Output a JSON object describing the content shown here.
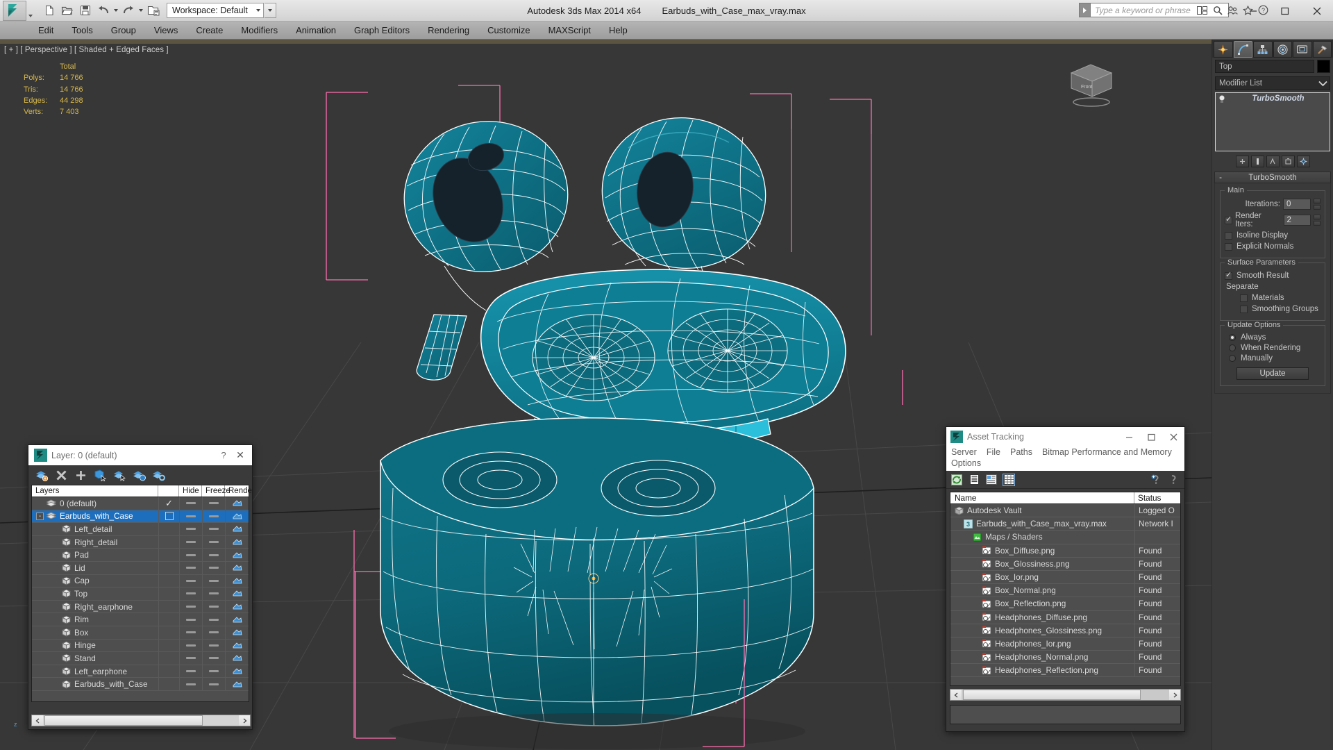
{
  "titlebar": {
    "logo_name": "3ds-max-logo",
    "workspace_label": "Workspace: Default",
    "app_title": "Autodesk 3ds Max  2014 x64",
    "file_name": "Earbuds_with_Case_max_vray.max",
    "search_placeholder": "Type a keyword or phrase",
    "quick_access": [
      {
        "name": "new-file-icon",
        "tip": "New"
      },
      {
        "name": "open-file-icon",
        "tip": "Open"
      },
      {
        "name": "save-file-icon",
        "tip": "Save"
      },
      {
        "name": "undo-icon",
        "tip": "Undo"
      },
      {
        "name": "redo-icon",
        "tip": "Redo"
      },
      {
        "name": "set-project-folder-icon",
        "tip": "Set Project Folder"
      }
    ],
    "right_icons": [
      {
        "name": "workspace-switch-icon"
      },
      {
        "name": "search-icon"
      },
      {
        "name": "community-icon"
      },
      {
        "name": "favorites-icon"
      },
      {
        "name": "help-icon"
      }
    ],
    "window_controls": {
      "minimize": "–",
      "maximize": "□",
      "close": "✕"
    }
  },
  "menubar": {
    "items": [
      "Edit",
      "Tools",
      "Group",
      "Views",
      "Create",
      "Modifiers",
      "Animation",
      "Graph Editors",
      "Rendering",
      "Customize",
      "MAXScript",
      "Help"
    ]
  },
  "viewport": {
    "label": "[ + ] [ Perspective ] [ Shaded + Edged Faces ]",
    "stats_header": "Total",
    "stats": [
      {
        "label": "Polys:",
        "value": "14 766"
      },
      {
        "label": "Tris:",
        "value": "14 766"
      },
      {
        "label": "Edges:",
        "value": "44 298"
      },
      {
        "label": "Verts:",
        "value": "7 403"
      }
    ],
    "axis_z_label": "z",
    "viewcube_label": "Front",
    "colors": {
      "background": "#373737",
      "mesh_fill": "#0b6b7d",
      "mesh_fill_light": "#158ba3",
      "wireframe": "#ffffff",
      "selection_bracket": "#ff78b4",
      "grid": "#4a4a4a"
    }
  },
  "command_panel": {
    "tabs": [
      {
        "name": "create-tab",
        "icon": "star-icon",
        "active": false
      },
      {
        "name": "modify-tab",
        "icon": "curve-icon",
        "active": true
      },
      {
        "name": "hierarchy-tab",
        "icon": "hierarchy-icon",
        "active": false
      },
      {
        "name": "motion-tab",
        "icon": "motion-icon",
        "active": false
      },
      {
        "name": "display-tab",
        "icon": "display-icon",
        "active": false
      },
      {
        "name": "utilities-tab",
        "icon": "hammer-icon",
        "active": false
      }
    ],
    "object_name": "Top",
    "object_color": "#000000",
    "modifier_list_label": "Modifier List",
    "modifier_stack": [
      {
        "name": "TurboSmooth",
        "light_bulb": true
      }
    ],
    "stack_buttons": [
      {
        "name": "pin-stack-button"
      },
      {
        "name": "show-end-result-button"
      },
      {
        "name": "make-unique-button"
      },
      {
        "name": "remove-modifier-button"
      },
      {
        "name": "configure-modifier-sets-button"
      }
    ],
    "rollout": {
      "title": "TurboSmooth",
      "collapse_glyph": "-",
      "groups": [
        {
          "title": "Main",
          "fields": [
            {
              "label": "Iterations:",
              "value": "0"
            },
            {
              "label": "Render Iters:",
              "value": "2",
              "checkbox": true,
              "checked": true
            }
          ],
          "checkboxes": [
            {
              "label": "Isoline Display",
              "checked": false
            },
            {
              "label": "Explicit Normals",
              "checked": false
            }
          ]
        },
        {
          "title": "Surface Parameters",
          "checkboxes": [
            {
              "label": "Smooth Result",
              "checked": true
            }
          ],
          "sublabel": "Separate",
          "sub_checkboxes": [
            {
              "label": "Materials",
              "checked": false
            },
            {
              "label": "Smoothing Groups",
              "checked": false
            }
          ]
        },
        {
          "title": "Update Options",
          "radios": [
            {
              "label": "Always",
              "checked": true
            },
            {
              "label": "When Rendering",
              "checked": false
            },
            {
              "label": "Manually",
              "checked": false
            }
          ],
          "button": "Update"
        }
      ]
    }
  },
  "layer_dialog": {
    "title": "Layer: 0 (default)",
    "help_glyph": "?",
    "close_glyph": "✕",
    "toolbar": [
      {
        "name": "create-new-layer-icon"
      },
      {
        "name": "delete-layer-icon"
      },
      {
        "name": "add-layer-icon"
      },
      {
        "name": "select-objects-in-layer-icon"
      },
      {
        "name": "select-highlighted-objects-icon"
      },
      {
        "name": "highlight-selected-objects-icon"
      },
      {
        "name": "layer-properties-icon"
      }
    ],
    "columns": [
      "Layers",
      "",
      "Hide",
      "Freeze",
      "Rende"
    ],
    "rows": [
      {
        "name": "0 (default)",
        "indent": 0,
        "icon": "layer-icon",
        "check": "✓",
        "selected": false,
        "expander": ""
      },
      {
        "name": "Earbuds_with_Case",
        "indent": 0,
        "icon": "layer-icon",
        "check": "box",
        "selected": true,
        "expander": "-"
      },
      {
        "name": "Left_detail",
        "indent": 1,
        "icon": "object-icon",
        "check": "",
        "selected": false,
        "expander": ""
      },
      {
        "name": "Right_detail",
        "indent": 1,
        "icon": "object-icon",
        "check": "",
        "selected": false,
        "expander": ""
      },
      {
        "name": "Pad",
        "indent": 1,
        "icon": "object-icon",
        "check": "",
        "selected": false,
        "expander": ""
      },
      {
        "name": "Lid",
        "indent": 1,
        "icon": "object-icon",
        "check": "",
        "selected": false,
        "expander": ""
      },
      {
        "name": "Cap",
        "indent": 1,
        "icon": "object-icon",
        "check": "",
        "selected": false,
        "expander": ""
      },
      {
        "name": "Top",
        "indent": 1,
        "icon": "object-icon",
        "check": "",
        "selected": false,
        "expander": ""
      },
      {
        "name": "Right_earphone",
        "indent": 1,
        "icon": "object-icon",
        "check": "",
        "selected": false,
        "expander": ""
      },
      {
        "name": "Rim",
        "indent": 1,
        "icon": "object-icon",
        "check": "",
        "selected": false,
        "expander": ""
      },
      {
        "name": "Box",
        "indent": 1,
        "icon": "object-icon",
        "check": "",
        "selected": false,
        "expander": ""
      },
      {
        "name": "Hinge",
        "indent": 1,
        "icon": "object-icon",
        "check": "",
        "selected": false,
        "expander": ""
      },
      {
        "name": "Stand",
        "indent": 1,
        "icon": "object-icon",
        "check": "",
        "selected": false,
        "expander": ""
      },
      {
        "name": "Left_earphone",
        "indent": 1,
        "icon": "object-icon",
        "check": "",
        "selected": false,
        "expander": ""
      },
      {
        "name": "Earbuds_with_Case",
        "indent": 1,
        "icon": "object-icon",
        "check": "",
        "selected": false,
        "expander": ""
      }
    ]
  },
  "asset_dialog": {
    "title": "Asset Tracking",
    "window_controls": {
      "minimize": "–",
      "maximize": "□",
      "close": "✕"
    },
    "menu": [
      "Server",
      "File",
      "Paths",
      "Bitmap Performance and Memory",
      "Options"
    ],
    "toolbar": [
      {
        "name": "refresh-icon",
        "active": false
      },
      {
        "name": "list-view-icon",
        "active": false
      },
      {
        "name": "detail-view-icon",
        "active": false
      },
      {
        "name": "table-view-icon",
        "active": true
      }
    ],
    "toolbar_right": [
      {
        "name": "help-add-icon"
      },
      {
        "name": "help-icon"
      }
    ],
    "columns": [
      "Name",
      "Status"
    ],
    "rows": [
      {
        "name": "Autodesk Vault",
        "status": "Logged O",
        "indent": 0,
        "icon": "vault-icon"
      },
      {
        "name": "Earbuds_with_Case_max_vray.max",
        "status": "Network I",
        "indent": 1,
        "icon": "max-file-icon"
      },
      {
        "name": "Maps / Shaders",
        "status": "",
        "indent": 2,
        "icon": "maps-icon"
      },
      {
        "name": "Box_Diffuse.png",
        "status": "Found",
        "indent": 3,
        "icon": "bitmap-icon"
      },
      {
        "name": "Box_Glossiness.png",
        "status": "Found",
        "indent": 3,
        "icon": "bitmap-icon"
      },
      {
        "name": "Box_Ior.png",
        "status": "Found",
        "indent": 3,
        "icon": "bitmap-icon"
      },
      {
        "name": "Box_Normal.png",
        "status": "Found",
        "indent": 3,
        "icon": "bitmap-icon"
      },
      {
        "name": "Box_Reflection.png",
        "status": "Found",
        "indent": 3,
        "icon": "bitmap-icon"
      },
      {
        "name": "Headphones_Diffuse.png",
        "status": "Found",
        "indent": 3,
        "icon": "bitmap-icon"
      },
      {
        "name": "Headphones_Glossiness.png",
        "status": "Found",
        "indent": 3,
        "icon": "bitmap-icon"
      },
      {
        "name": "Headphones_Ior.png",
        "status": "Found",
        "indent": 3,
        "icon": "bitmap-icon"
      },
      {
        "name": "Headphones_Normal.png",
        "status": "Found",
        "indent": 3,
        "icon": "bitmap-icon"
      },
      {
        "name": "Headphones_Reflection.png",
        "status": "Found",
        "indent": 3,
        "icon": "bitmap-icon"
      }
    ]
  }
}
